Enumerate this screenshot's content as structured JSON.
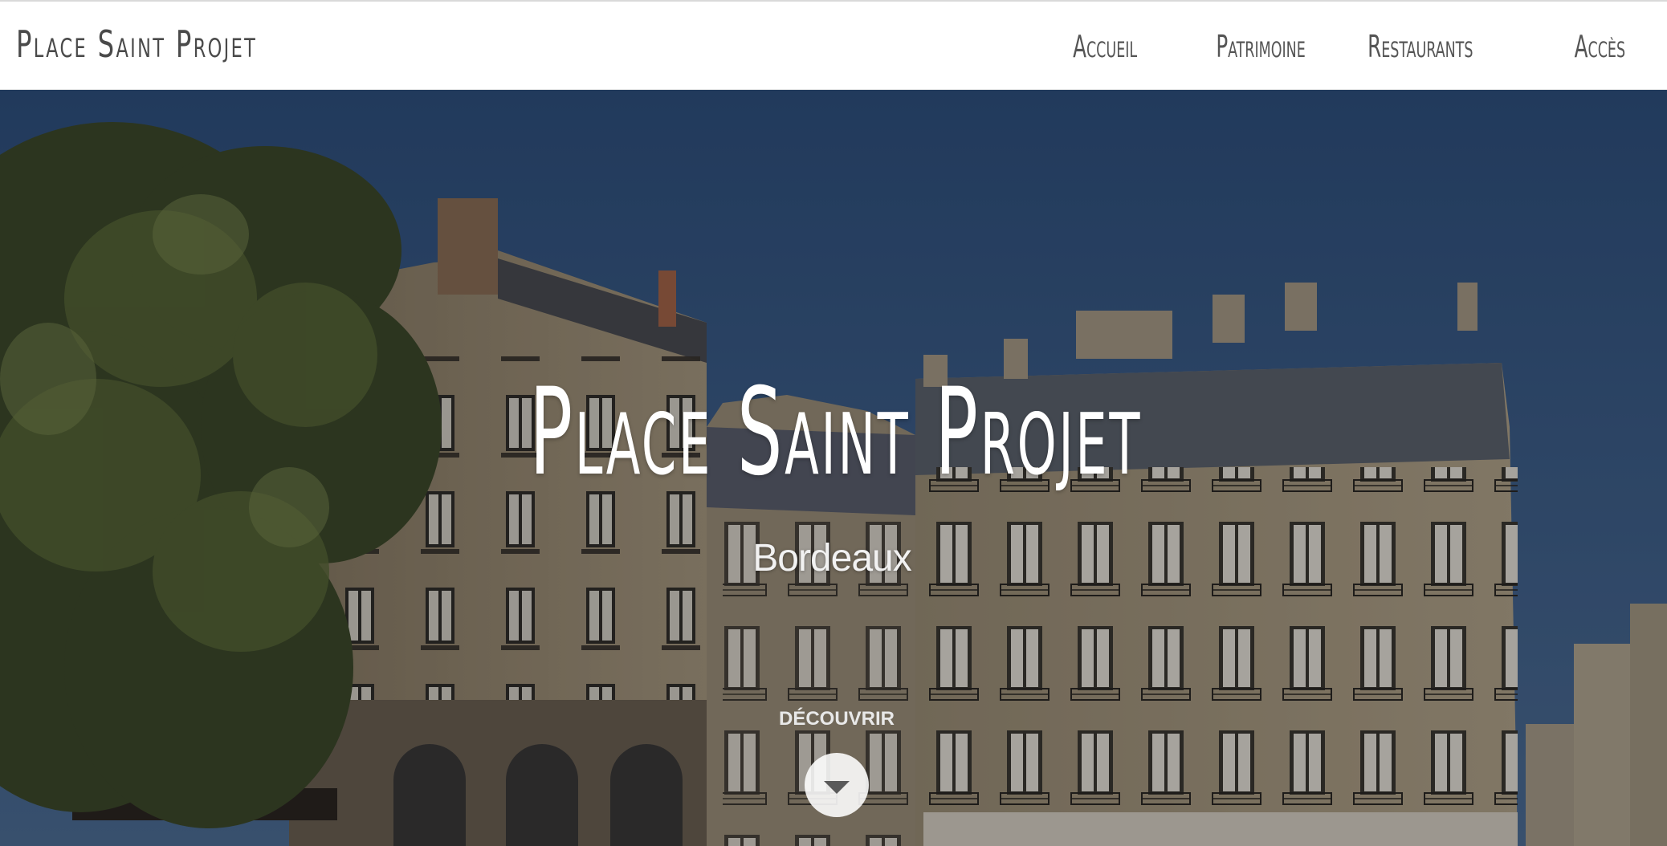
{
  "header": {
    "brand": "Place Saint Projet",
    "nav": [
      {
        "label": "Accueil"
      },
      {
        "label": "Patrimoine"
      },
      {
        "label": "Restaurants"
      },
      {
        "label": "Accès"
      }
    ]
  },
  "hero": {
    "title": "Place Saint Projet",
    "subtitle": "Bordeaux",
    "cta_label": "DÉCOUVRIR",
    "cta_icon": "caret-down-icon"
  },
  "colors": {
    "nav_text": "#555555",
    "sky": "#3b5e8a",
    "hero_text": "#ffffff"
  }
}
